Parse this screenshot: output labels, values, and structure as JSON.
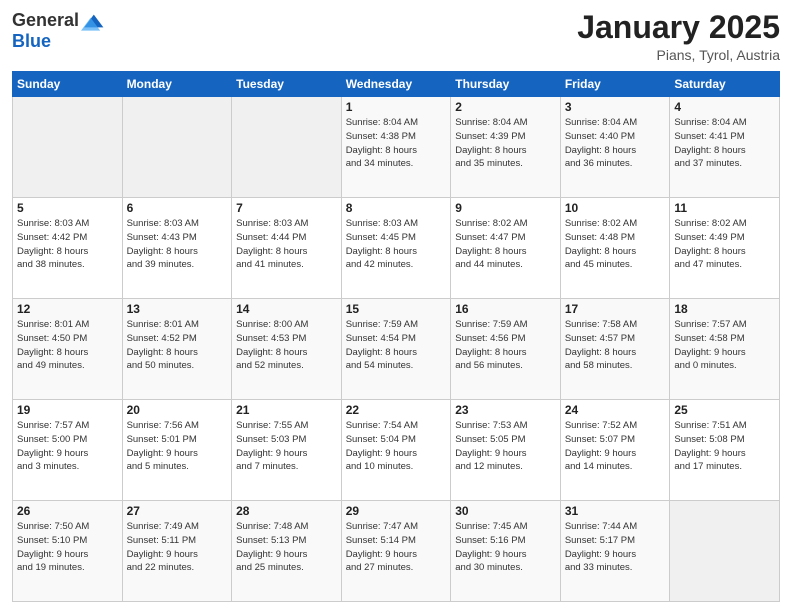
{
  "header": {
    "logo_general": "General",
    "logo_blue": "Blue",
    "month": "January 2025",
    "location": "Pians, Tyrol, Austria"
  },
  "days_of_week": [
    "Sunday",
    "Monday",
    "Tuesday",
    "Wednesday",
    "Thursday",
    "Friday",
    "Saturday"
  ],
  "weeks": [
    [
      {
        "day": "",
        "info": ""
      },
      {
        "day": "",
        "info": ""
      },
      {
        "day": "",
        "info": ""
      },
      {
        "day": "1",
        "info": "Sunrise: 8:04 AM\nSunset: 4:38 PM\nDaylight: 8 hours\nand 34 minutes."
      },
      {
        "day": "2",
        "info": "Sunrise: 8:04 AM\nSunset: 4:39 PM\nDaylight: 8 hours\nand 35 minutes."
      },
      {
        "day": "3",
        "info": "Sunrise: 8:04 AM\nSunset: 4:40 PM\nDaylight: 8 hours\nand 36 minutes."
      },
      {
        "day": "4",
        "info": "Sunrise: 8:04 AM\nSunset: 4:41 PM\nDaylight: 8 hours\nand 37 minutes."
      }
    ],
    [
      {
        "day": "5",
        "info": "Sunrise: 8:03 AM\nSunset: 4:42 PM\nDaylight: 8 hours\nand 38 minutes."
      },
      {
        "day": "6",
        "info": "Sunrise: 8:03 AM\nSunset: 4:43 PM\nDaylight: 8 hours\nand 39 minutes."
      },
      {
        "day": "7",
        "info": "Sunrise: 8:03 AM\nSunset: 4:44 PM\nDaylight: 8 hours\nand 41 minutes."
      },
      {
        "day": "8",
        "info": "Sunrise: 8:03 AM\nSunset: 4:45 PM\nDaylight: 8 hours\nand 42 minutes."
      },
      {
        "day": "9",
        "info": "Sunrise: 8:02 AM\nSunset: 4:47 PM\nDaylight: 8 hours\nand 44 minutes."
      },
      {
        "day": "10",
        "info": "Sunrise: 8:02 AM\nSunset: 4:48 PM\nDaylight: 8 hours\nand 45 minutes."
      },
      {
        "day": "11",
        "info": "Sunrise: 8:02 AM\nSunset: 4:49 PM\nDaylight: 8 hours\nand 47 minutes."
      }
    ],
    [
      {
        "day": "12",
        "info": "Sunrise: 8:01 AM\nSunset: 4:50 PM\nDaylight: 8 hours\nand 49 minutes."
      },
      {
        "day": "13",
        "info": "Sunrise: 8:01 AM\nSunset: 4:52 PM\nDaylight: 8 hours\nand 50 minutes."
      },
      {
        "day": "14",
        "info": "Sunrise: 8:00 AM\nSunset: 4:53 PM\nDaylight: 8 hours\nand 52 minutes."
      },
      {
        "day": "15",
        "info": "Sunrise: 7:59 AM\nSunset: 4:54 PM\nDaylight: 8 hours\nand 54 minutes."
      },
      {
        "day": "16",
        "info": "Sunrise: 7:59 AM\nSunset: 4:56 PM\nDaylight: 8 hours\nand 56 minutes."
      },
      {
        "day": "17",
        "info": "Sunrise: 7:58 AM\nSunset: 4:57 PM\nDaylight: 8 hours\nand 58 minutes."
      },
      {
        "day": "18",
        "info": "Sunrise: 7:57 AM\nSunset: 4:58 PM\nDaylight: 9 hours\nand 0 minutes."
      }
    ],
    [
      {
        "day": "19",
        "info": "Sunrise: 7:57 AM\nSunset: 5:00 PM\nDaylight: 9 hours\nand 3 minutes."
      },
      {
        "day": "20",
        "info": "Sunrise: 7:56 AM\nSunset: 5:01 PM\nDaylight: 9 hours\nand 5 minutes."
      },
      {
        "day": "21",
        "info": "Sunrise: 7:55 AM\nSunset: 5:03 PM\nDaylight: 9 hours\nand 7 minutes."
      },
      {
        "day": "22",
        "info": "Sunrise: 7:54 AM\nSunset: 5:04 PM\nDaylight: 9 hours\nand 10 minutes."
      },
      {
        "day": "23",
        "info": "Sunrise: 7:53 AM\nSunset: 5:05 PM\nDaylight: 9 hours\nand 12 minutes."
      },
      {
        "day": "24",
        "info": "Sunrise: 7:52 AM\nSunset: 5:07 PM\nDaylight: 9 hours\nand 14 minutes."
      },
      {
        "day": "25",
        "info": "Sunrise: 7:51 AM\nSunset: 5:08 PM\nDaylight: 9 hours\nand 17 minutes."
      }
    ],
    [
      {
        "day": "26",
        "info": "Sunrise: 7:50 AM\nSunset: 5:10 PM\nDaylight: 9 hours\nand 19 minutes."
      },
      {
        "day": "27",
        "info": "Sunrise: 7:49 AM\nSunset: 5:11 PM\nDaylight: 9 hours\nand 22 minutes."
      },
      {
        "day": "28",
        "info": "Sunrise: 7:48 AM\nSunset: 5:13 PM\nDaylight: 9 hours\nand 25 minutes."
      },
      {
        "day": "29",
        "info": "Sunrise: 7:47 AM\nSunset: 5:14 PM\nDaylight: 9 hours\nand 27 minutes."
      },
      {
        "day": "30",
        "info": "Sunrise: 7:45 AM\nSunset: 5:16 PM\nDaylight: 9 hours\nand 30 minutes."
      },
      {
        "day": "31",
        "info": "Sunrise: 7:44 AM\nSunset: 5:17 PM\nDaylight: 9 hours\nand 33 minutes."
      },
      {
        "day": "",
        "info": ""
      }
    ]
  ]
}
